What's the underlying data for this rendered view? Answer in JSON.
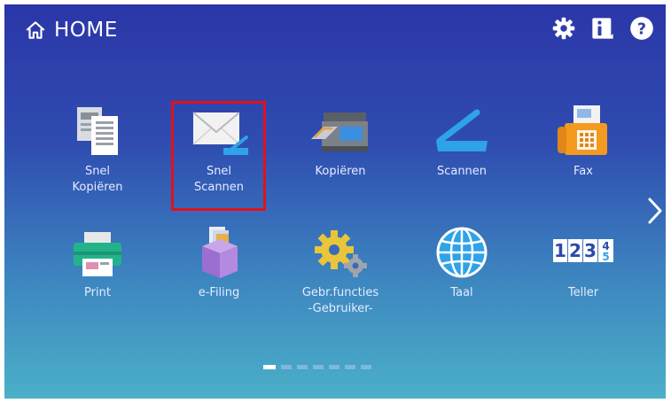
{
  "header": {
    "title": "HOME",
    "icons": [
      "home-icon",
      "settings-gear-icon",
      "info-icon",
      "help-icon"
    ]
  },
  "tiles": [
    {
      "id": "snel-kopieren",
      "label_line1": "Snel",
      "label_line2": "Kopiëren",
      "icon": "quick-copy-icon"
    },
    {
      "id": "snel-scannen",
      "label_line1": "Snel",
      "label_line2": "Scannen",
      "icon": "quick-scan-envelope-icon"
    },
    {
      "id": "kopieren",
      "label_line1": "Kopiëren",
      "label_line2": "",
      "icon": "copier-icon"
    },
    {
      "id": "scannen",
      "label_line1": "Scannen",
      "label_line2": "",
      "icon": "scanner-icon"
    },
    {
      "id": "fax",
      "label_line1": "Fax",
      "label_line2": "",
      "icon": "fax-icon"
    },
    {
      "id": "print",
      "label_line1": "Print",
      "label_line2": "",
      "icon": "printer-icon"
    },
    {
      "id": "e-filing",
      "label_line1": "e-Filing",
      "label_line2": "",
      "icon": "e-filing-box-icon"
    },
    {
      "id": "gebr-functies",
      "label_line1": "Gebr.functies",
      "label_line2": "-Gebruiker-",
      "icon": "gears-icon"
    },
    {
      "id": "taal",
      "label_line1": "Taal",
      "label_line2": "",
      "icon": "globe-icon"
    },
    {
      "id": "teller",
      "label_line1": "Teller",
      "label_line2": "",
      "icon": "counter-icon"
    }
  ],
  "counter_digits": [
    "1",
    "2",
    "3",
    "4",
    "5"
  ],
  "pagination": {
    "pages": 7,
    "current": 1
  },
  "colors": {
    "highlight": "#e0121b",
    "accent": "#2fa3e8"
  }
}
